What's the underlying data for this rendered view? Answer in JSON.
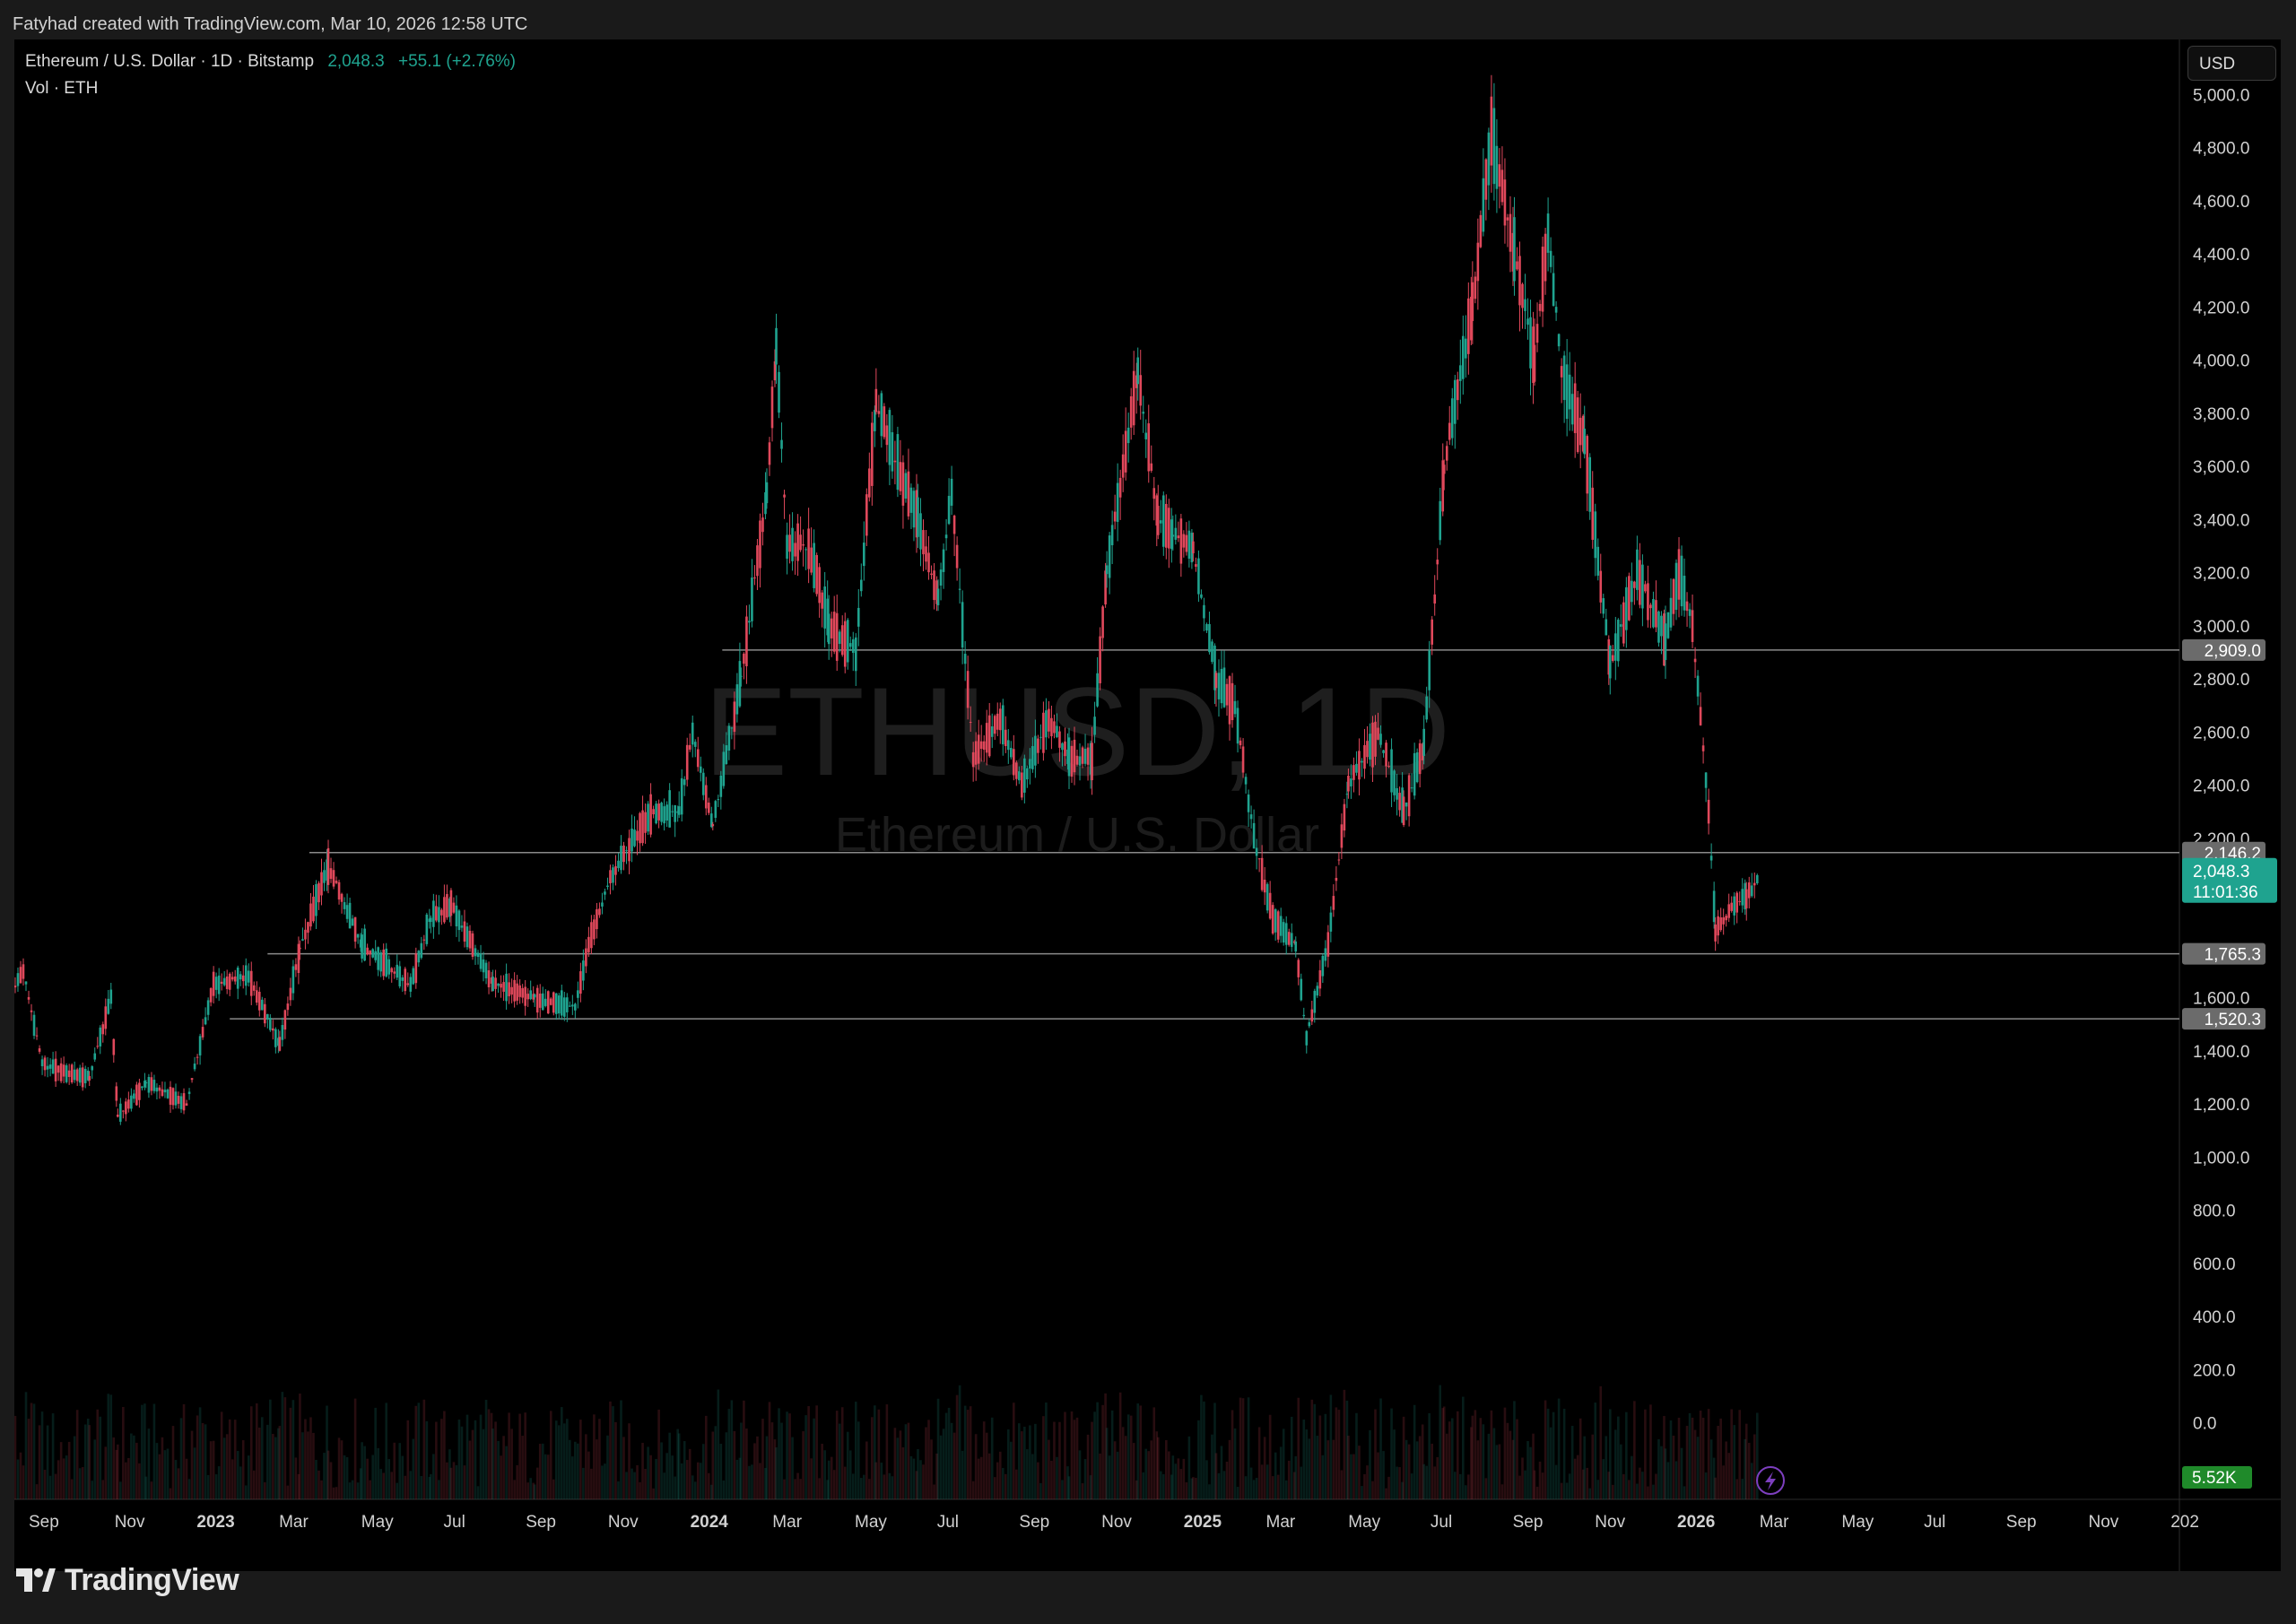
{
  "header": {
    "attribution": "Fatyhad created with TradingView.com, Mar 10, 2026 12:58 UTC"
  },
  "legend": {
    "symbol": "Ethereum / U.S. Dollar · 1D · Bitstamp",
    "price": "2,048.3",
    "change": "+55.1 (+2.76%)",
    "volume_label": "Vol · ETH"
  },
  "watermark": {
    "ticker": "ETHUSD, 1D",
    "name": "Ethereum / U.S. Dollar"
  },
  "price_scale": {
    "currency_button": "USD"
  },
  "brand": {
    "logo_text": "TradingView",
    "logo_icon": "tradingview-logo-icon"
  },
  "colors": {
    "up": "#1fa38f",
    "down": "#e0485b",
    "background": "#000000",
    "volume_badge": "#1f8a2a"
  },
  "chart_data": {
    "type": "candlestick",
    "symbol": "ETHUSD",
    "interval": "1D",
    "exchange": "Bitstamp",
    "y_axis": {
      "ticks": [
        "5,000.0",
        "4,800.0",
        "4,600.0",
        "4,400.0",
        "4,200.0",
        "4,000.0",
        "3,800.0",
        "3,600.0",
        "3,400.0",
        "3,200.0",
        "3,000.0",
        "2,800.0",
        "2,600.0",
        "2,400.0",
        "2,200.0",
        "1,600.0",
        "1,400.0",
        "1,200.0",
        "1,000.0",
        "800.0",
        "600.0",
        "400.0",
        "200.0",
        "0.0"
      ],
      "ylim": [
        0,
        5000
      ]
    },
    "x_axis": {
      "ticks": [
        "Sep",
        "Nov",
        "2023",
        "Mar",
        "May",
        "Jul",
        "Sep",
        "Nov",
        "2024",
        "Mar",
        "May",
        "Jul",
        "Sep",
        "Nov",
        "2025",
        "Mar",
        "May",
        "Jul",
        "Sep",
        "Nov",
        "2026",
        "Mar",
        "May",
        "Jul",
        "Sep",
        "Nov",
        "202"
      ],
      "bold_ticks": [
        "2023",
        "2024",
        "2025",
        "2026"
      ]
    },
    "horizontal_levels": [
      {
        "value": 2909.0,
        "label": "2,909.0",
        "from": "2024-02"
      },
      {
        "value": 2146.2,
        "label": "2,146.2",
        "from": "2023-04"
      },
      {
        "value": 1765.3,
        "label": "1,765.3",
        "from": "2023-03"
      },
      {
        "value": 1520.3,
        "label": "1,520.3",
        "from": "2023-02"
      }
    ],
    "last_price": {
      "value": 2048.3,
      "label": "2,048.3",
      "countdown": "11:01:36"
    },
    "volume_last": "5.52K",
    "price_path": [
      [
        "2022-08-20",
        1600
      ],
      [
        "2022-09-01",
        1700
      ],
      [
        "2022-09-15",
        1350
      ],
      [
        "2022-10-01",
        1320
      ],
      [
        "2022-10-20",
        1300
      ],
      [
        "2022-11-05",
        1600
      ],
      [
        "2022-11-10",
        1150
      ],
      [
        "2022-12-01",
        1280
      ],
      [
        "2022-12-31",
        1200
      ],
      [
        "2023-01-20",
        1650
      ],
      [
        "2023-02-15",
        1680
      ],
      [
        "2023-03-10",
        1420
      ],
      [
        "2023-03-25",
        1780
      ],
      [
        "2023-04-15",
        2100
      ],
      [
        "2023-05-10",
        1800
      ],
      [
        "2023-06-15",
        1650
      ],
      [
        "2023-06-30",
        1900
      ],
      [
        "2023-07-15",
        1950
      ],
      [
        "2023-08-15",
        1650
      ],
      [
        "2023-09-15",
        1600
      ],
      [
        "2023-10-15",
        1560
      ],
      [
        "2023-10-25",
        1800
      ],
      [
        "2023-11-10",
        2050
      ],
      [
        "2023-12-10",
        2300
      ],
      [
        "2023-12-31",
        2300
      ],
      [
        "2024-01-10",
        2600
      ],
      [
        "2024-01-25",
        2250
      ],
      [
        "2024-02-15",
        2800
      ],
      [
        "2024-03-05",
        3500
      ],
      [
        "2024-03-12",
        4050
      ],
      [
        "2024-03-20",
        3300
      ],
      [
        "2024-04-05",
        3300
      ],
      [
        "2024-04-20",
        3000
      ],
      [
        "2024-05-10",
        2900
      ],
      [
        "2024-05-25",
        3850
      ],
      [
        "2024-06-10",
        3600
      ],
      [
        "2024-06-25",
        3400
      ],
      [
        "2024-07-10",
        3100
      ],
      [
        "2024-07-20",
        3500
      ],
      [
        "2024-08-05",
        2500
      ],
      [
        "2024-08-25",
        2650
      ],
      [
        "2024-09-10",
        2400
      ],
      [
        "2024-09-30",
        2650
      ],
      [
        "2024-10-15",
        2500
      ],
      [
        "2024-11-01",
        2500
      ],
      [
        "2024-11-12",
        3200
      ],
      [
        "2024-12-05",
        3950
      ],
      [
        "2024-12-20",
        3400
      ],
      [
        "2024-12-31",
        3350
      ],
      [
        "2025-01-15",
        3300
      ],
      [
        "2025-02-01",
        2800
      ],
      [
        "2025-02-15",
        2700
      ],
      [
        "2025-03-01",
        2200
      ],
      [
        "2025-03-15",
        1900
      ],
      [
        "2025-04-01",
        1800
      ],
      [
        "2025-04-09",
        1450
      ],
      [
        "2025-04-25",
        1800
      ],
      [
        "2025-05-10",
        2400
      ],
      [
        "2025-06-01",
        2600
      ],
      [
        "2025-06-20",
        2300
      ],
      [
        "2025-07-05",
        2550
      ],
      [
        "2025-07-20",
        3600
      ],
      [
        "2025-08-10",
        4200
      ],
      [
        "2025-08-24",
        4850
      ],
      [
        "2025-09-10",
        4400
      ],
      [
        "2025-09-25",
        4000
      ],
      [
        "2025-10-05",
        4500
      ],
      [
        "2025-10-15",
        3950
      ],
      [
        "2025-11-01",
        3700
      ],
      [
        "2025-11-20",
        2850
      ],
      [
        "2025-12-10",
        3200
      ],
      [
        "2025-12-31",
        2950
      ],
      [
        "2026-01-10",
        3200
      ],
      [
        "2026-01-20",
        3000
      ],
      [
        "2026-02-01",
        2300
      ],
      [
        "2026-02-06",
        1850
      ],
      [
        "2026-02-20",
        1950
      ],
      [
        "2026-03-01",
        1980
      ],
      [
        "2026-03-10",
        2048
      ]
    ]
  }
}
